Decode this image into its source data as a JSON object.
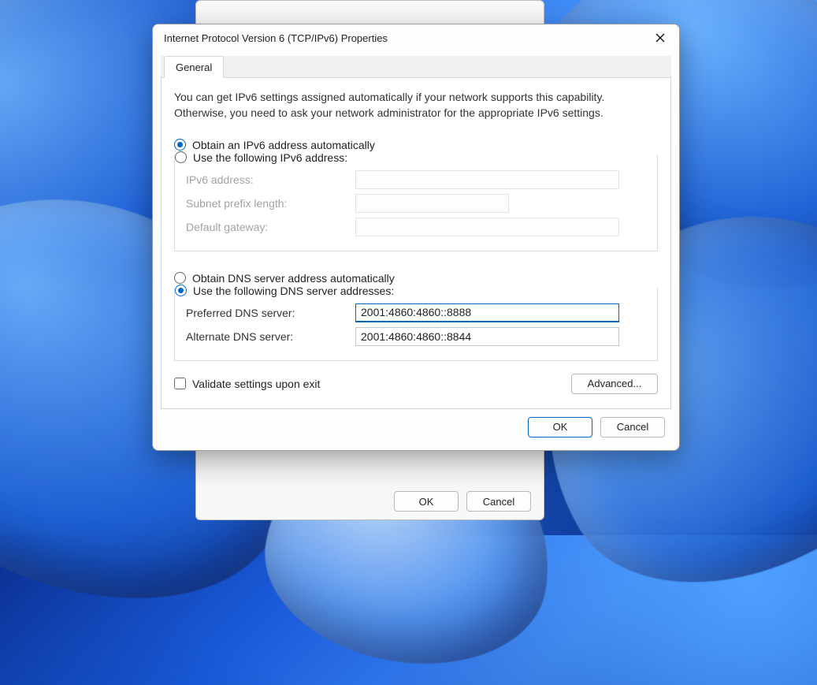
{
  "window": {
    "title": "Internet Protocol Version 6 (TCP/IPv6) Properties"
  },
  "tabs": {
    "general": "General"
  },
  "description": "You can get IPv6 settings assigned automatically if your network supports this capability. Otherwise, you need to ask your network administrator for the appropriate IPv6 settings.",
  "ip_section": {
    "radio_auto": "Obtain an IPv6 address automatically",
    "radio_manual": "Use the following IPv6 address:",
    "fields": {
      "address_label": "IPv6 address:",
      "address_value": "",
      "prefix_label": "Subnet prefix length:",
      "prefix_value": "",
      "gateway_label": "Default gateway:",
      "gateway_value": ""
    }
  },
  "dns_section": {
    "radio_auto": "Obtain DNS server address automatically",
    "radio_manual": "Use the following DNS server addresses:",
    "fields": {
      "preferred_label": "Preferred DNS server:",
      "preferred_value": "2001:4860:4860::8888",
      "alternate_label": "Alternate DNS server:",
      "alternate_value": "2001:4860:4860::8844"
    }
  },
  "validate_checkbox": "Validate settings upon exit",
  "buttons": {
    "advanced": "Advanced...",
    "ok": "OK",
    "cancel": "Cancel"
  },
  "parent_buttons": {
    "ok": "OK",
    "cancel": "Cancel"
  }
}
